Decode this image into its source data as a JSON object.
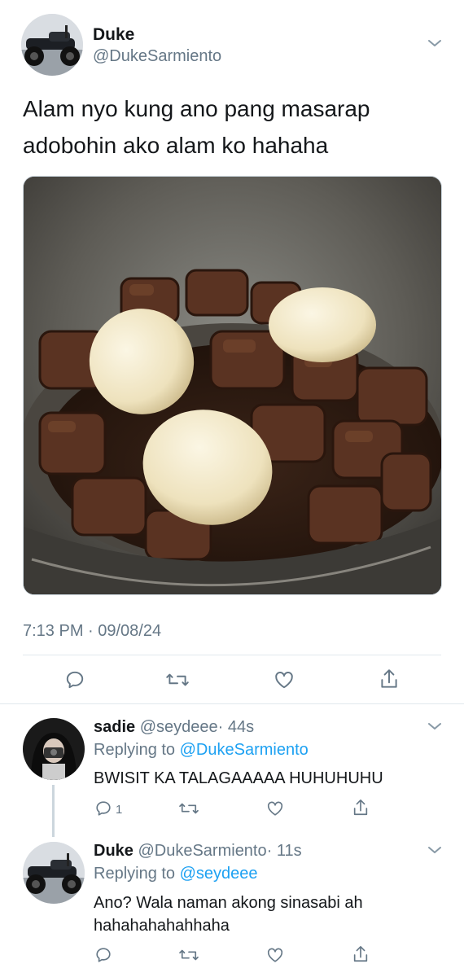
{
  "main_tweet": {
    "author_name": "Duke",
    "author_handle": "@DukeSarmiento",
    "text_line1": "Alam nyo kung ano pang masarap",
    "text_line2": "adobohin ako alam ko hahaha",
    "timestamp": "7:13 PM · 09/08/24",
    "avatar_icon": "motorcycle-avatar",
    "image_icon": "adobo-pot-photo"
  },
  "replies": [
    {
      "name": "sadie",
      "handle": "@seydeee",
      "time": "· 44s",
      "replying_prefix": "Replying to",
      "replying_to": "@DukeSarmiento",
      "text_line1": "BWISIT KA TALAGAAAAA HUHUHUHU",
      "reply_count": "1"
    },
    {
      "name": "Duke",
      "handle": "@DukeSarmiento",
      "time": "· 11s",
      "replying_prefix": "Replying to",
      "replying_to": "@seydeee",
      "text_line1": "Ano? Wala naman akong sinasabi ah",
      "text_line2": "hahahahahahhaha"
    }
  ],
  "colors": {
    "link": "#1da1f2",
    "muted": "#657786",
    "text": "#14171a",
    "divider": "#e1e8ed"
  }
}
